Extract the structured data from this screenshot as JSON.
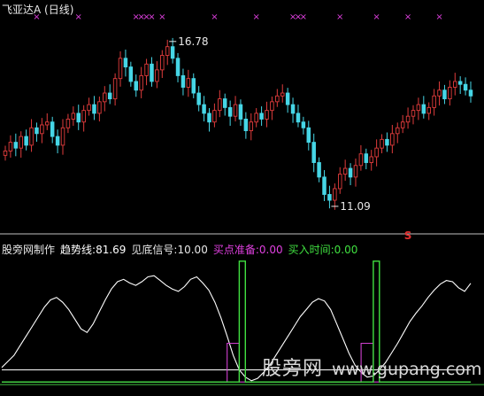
{
  "header": {
    "stock_name": "飞亚达A",
    "period": "(日线)"
  },
  "indicator": {
    "name": "股旁网制作",
    "trend_label": "趋势线:",
    "trend_value": "81.69",
    "bottom_label": "见底信号:",
    "bottom_value": "10.00",
    "buy_prep_label": "买点准备:",
    "buy_prep_value": "0.00",
    "buy_time_label": "买入时间:",
    "buy_time_value": "0.00"
  },
  "watermark": {
    "text": "股旁网",
    "url": "www.gupang.com"
  },
  "colors": {
    "up": "#e03c3c",
    "down": "#46d6e6",
    "trend": "#ffffff",
    "prep": "#d040d0",
    "buy": "#40e040",
    "marker": "#e040e0",
    "s_mark": "#e03030"
  },
  "chart_data": [
    {
      "type": "candlestick",
      "title": "飞亚达A (日线)",
      "ylim": [
        10.2,
        17.6
      ],
      "annotations": [
        {
          "label": "16.78",
          "value": 16.78,
          "type": "high"
        },
        {
          "label": "11.09",
          "value": 11.09,
          "type": "low"
        }
      ],
      "marker_symbol": "×",
      "signal_label": "S",
      "closes": [
        13.0,
        13.3,
        13.1,
        13.5,
        13.2,
        13.8,
        13.6,
        13.9,
        14.0,
        13.5,
        13.2,
        13.8,
        14.1,
        14.3,
        14.0,
        14.4,
        14.6,
        14.3,
        14.7,
        15.0,
        14.8,
        15.5,
        16.2,
        15.9,
        15.4,
        15.1,
        15.6,
        16.0,
        15.4,
        15.8,
        16.3,
        16.6,
        16.2,
        15.6,
        15.2,
        15.5,
        15.0,
        14.6,
        14.3,
        14.0,
        14.4,
        14.8,
        14.5,
        14.2,
        14.6,
        14.1,
        13.7,
        14.0,
        14.3,
        14.1,
        14.4,
        14.7,
        14.9,
        15.0,
        14.6,
        14.3,
        14.0,
        13.8,
        13.3,
        12.6,
        12.1,
        11.5,
        11.3,
        11.7,
        12.2,
        12.4,
        12.1,
        12.5,
        12.9,
        12.6,
        12.8,
        13.1,
        13.4,
        13.2,
        13.6,
        13.8,
        14.0,
        14.2,
        14.4,
        14.6,
        14.3,
        14.5,
        14.9,
        15.1,
        14.8,
        15.2,
        15.4,
        15.3,
        15.1,
        14.9
      ],
      "panel": "price"
    },
    {
      "type": "line",
      "panel": "indicator",
      "ylim": [
        -5,
        105
      ],
      "series": [
        {
          "name": "趋势线",
          "values": [
            12,
            17,
            22,
            30,
            38,
            46,
            54,
            62,
            68,
            70,
            66,
            60,
            52,
            44,
            41,
            48,
            58,
            68,
            77,
            83,
            85,
            82,
            80,
            83,
            87,
            88,
            84,
            80,
            77,
            75,
            79,
            85,
            87,
            82,
            76,
            66,
            53,
            38,
            22,
            10,
            4,
            1,
            3,
            8,
            14,
            22,
            30,
            38,
            46,
            54,
            60,
            66,
            69,
            67,
            60,
            48,
            36,
            24,
            14,
            8,
            4,
            5,
            10,
            16,
            24,
            32,
            41,
            50,
            57,
            63,
            70,
            76,
            81,
            84,
            83,
            78,
            75,
            81.69
          ]
        },
        {
          "name": "见底信号",
          "values": [
            10,
            10,
            10,
            10,
            10,
            10,
            10,
            10,
            10,
            10,
            10,
            10,
            10,
            10,
            10,
            10,
            10,
            10,
            10,
            10,
            10,
            10,
            10,
            10,
            10,
            10,
            10,
            10,
            10,
            10,
            10,
            10,
            10,
            10,
            10,
            10,
            10,
            10,
            10,
            10,
            10,
            10,
            10,
            10,
            10,
            10,
            10,
            10,
            10,
            10,
            10,
            10,
            10,
            10,
            10,
            10,
            10,
            10,
            10,
            10,
            10,
            10,
            10,
            10,
            10,
            10,
            10,
            10,
            10,
            10,
            10,
            10,
            10,
            10,
            10,
            10,
            10,
            10
          ]
        },
        {
          "name": "买点准备",
          "values": [
            0,
            0,
            0,
            0,
            0,
            0,
            0,
            0,
            0,
            0,
            0,
            0,
            0,
            0,
            0,
            0,
            0,
            0,
            0,
            0,
            0,
            0,
            0,
            0,
            0,
            0,
            0,
            0,
            0,
            0,
            0,
            0,
            0,
            0,
            0,
            0,
            0,
            32,
            32,
            0,
            0,
            0,
            0,
            0,
            0,
            0,
            0,
            0,
            0,
            0,
            0,
            0,
            0,
            0,
            0,
            0,
            0,
            0,
            0,
            32,
            32,
            0,
            0,
            0,
            0,
            0,
            0,
            0,
            0,
            0,
            0,
            0,
            0,
            0,
            0,
            0,
            0,
            0
          ]
        },
        {
          "name": "买入时间",
          "values": [
            0,
            0,
            0,
            0,
            0,
            0,
            0,
            0,
            0,
            0,
            0,
            0,
            0,
            0,
            0,
            0,
            0,
            0,
            0,
            0,
            0,
            0,
            0,
            0,
            0,
            0,
            0,
            0,
            0,
            0,
            0,
            0,
            0,
            0,
            0,
            0,
            0,
            0,
            0,
            100,
            0,
            0,
            0,
            0,
            0,
            0,
            0,
            0,
            0,
            0,
            0,
            0,
            0,
            0,
            0,
            0,
            0,
            0,
            0,
            0,
            0,
            100,
            0,
            0,
            0,
            0,
            0,
            0,
            0,
            0,
            0,
            0,
            0,
            0,
            0,
            0,
            0,
            0
          ]
        }
      ]
    }
  ]
}
